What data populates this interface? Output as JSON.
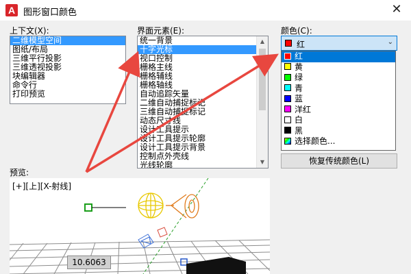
{
  "window": {
    "title": "图形窗口颜色"
  },
  "context": {
    "label": "上下文(X):",
    "items": [
      "二维模型空间",
      "图纸/布局",
      "三维平行投影",
      "三维透视投影",
      "块编辑器",
      "命令行",
      "打印预览"
    ],
    "selected": 0
  },
  "elements": {
    "label": "界面元素(E):",
    "items": [
      "统一背景",
      "十字光标",
      "视口控制",
      "栅格主线",
      "栅格辅线",
      "栅格轴线",
      "自动追踪矢量",
      "二维自动捕捉标记",
      "三维自动捕捉标记",
      "动态尺寸线",
      "设计工具提示",
      "设计工具提示轮廓",
      "设计工具提示背景",
      "控制点外壳线",
      "光线轮廓"
    ],
    "selected": 1
  },
  "color": {
    "label": "颜色(C):",
    "selected_label": "红",
    "selected_color": "#ff0000",
    "options": [
      {
        "label": "红",
        "color": "#ff0000"
      },
      {
        "label": "黄",
        "color": "#ffff00"
      },
      {
        "label": "绿",
        "color": "#00ff00"
      },
      {
        "label": "青",
        "color": "#00ffff"
      },
      {
        "label": "蓝",
        "color": "#0000ff"
      },
      {
        "label": "洋红",
        "color": "#ff00ff"
      },
      {
        "label": "白",
        "color": "#ffffff"
      },
      {
        "label": "黑",
        "color": "#000000"
      },
      {
        "label": "选择颜色...",
        "color": ""
      }
    ],
    "restore_button": "恢复传统颜色(L)"
  },
  "preview": {
    "label": "预览:",
    "viewport_label": "[+][上][X-射线]",
    "tooltip_value": "10.6063"
  },
  "annotation_color": "#e8473f"
}
